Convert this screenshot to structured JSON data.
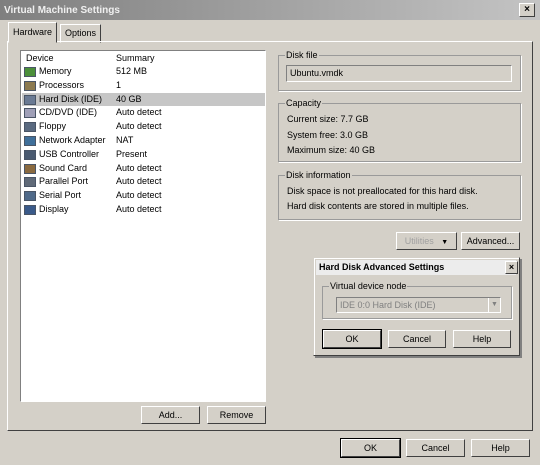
{
  "window": {
    "title": "Virtual Machine Settings",
    "close": "×"
  },
  "tabs": [
    {
      "label": "Hardware"
    },
    {
      "label": "Options"
    }
  ],
  "device_list": {
    "columns": [
      "Device",
      "Summary"
    ],
    "rows": [
      {
        "name": "Memory",
        "summary": "512 MB",
        "icon": "memory-icon"
      },
      {
        "name": "Processors",
        "summary": "1",
        "icon": "processor-icon"
      },
      {
        "name": "Hard Disk (IDE)",
        "summary": "40 GB",
        "icon": "hard-disk-icon",
        "selected": true
      },
      {
        "name": "CD/DVD (IDE)",
        "summary": "Auto detect",
        "icon": "cd-dvd-icon"
      },
      {
        "name": "Floppy",
        "summary": "Auto detect",
        "icon": "floppy-icon"
      },
      {
        "name": "Network Adapter",
        "summary": "NAT",
        "icon": "network-adapter-icon"
      },
      {
        "name": "USB Controller",
        "summary": "Present",
        "icon": "usb-icon"
      },
      {
        "name": "Sound Card",
        "summary": "Auto detect",
        "icon": "sound-card-icon"
      },
      {
        "name": "Parallel Port",
        "summary": "Auto detect",
        "icon": "parallel-port-icon"
      },
      {
        "name": "Serial Port",
        "summary": "Auto detect",
        "icon": "serial-port-icon"
      },
      {
        "name": "Display",
        "summary": "Auto detect",
        "icon": "display-icon"
      }
    ],
    "add_label": "Add...",
    "remove_label": "Remove"
  },
  "disk_file": {
    "title": "Disk file",
    "value": "Ubuntu.vmdk"
  },
  "capacity": {
    "title": "Capacity",
    "current": "Current size: 7.7 GB",
    "free": "System free: 3.0 GB",
    "max": "Maximum size: 40 GB"
  },
  "disk_info": {
    "title": "Disk information",
    "line1": "Disk space is not preallocated for this hard disk.",
    "line2": "Hard disk contents are stored in multiple files."
  },
  "utilities_label": "Utilities",
  "advanced_label": "Advanced...",
  "advanced_dialog": {
    "title": "Hard Disk Advanced Settings",
    "close": "×",
    "group_title": "Virtual device node",
    "device_node": "IDE 0:0  Hard Disk (IDE)",
    "ok": "OK",
    "cancel": "Cancel",
    "help": "Help"
  },
  "footer": {
    "ok": "OK",
    "cancel": "Cancel",
    "help": "Help"
  },
  "colors": {
    "selection": "#c6c6c6",
    "face": "#d4d0c8",
    "titlebar": "#8c8c8c"
  }
}
